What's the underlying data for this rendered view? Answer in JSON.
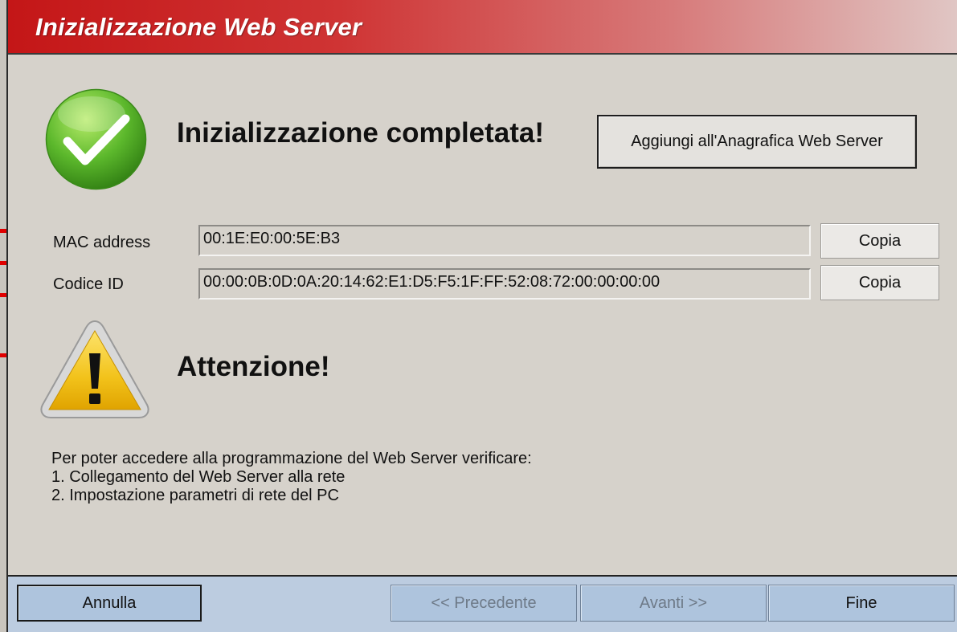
{
  "header": {
    "title": "Inizializzazione Web Server"
  },
  "success": {
    "title": "Inizializzazione completata!",
    "add_button_label": "Aggiungi all'Anagrafica Web Server",
    "icon": "checkmark-icon"
  },
  "fields": [
    {
      "label": "MAC address",
      "value": "00:1E:E0:00:5E:B3",
      "copy_label": "Copia"
    },
    {
      "label": "Codice ID",
      "value": "00:00:0B:0D:0A:20:14:62:E1:D5:F5:1F:FF:52:08:72:00:00:00:00",
      "copy_label": "Copia"
    }
  ],
  "warning": {
    "title": "Attenzione!",
    "icon": "warning-icon",
    "lines": [
      "Per poter accedere alla programmazione del Web Server verificare:",
      "1. Collegamento del Web Server alla rete",
      "2. Impostazione parametri di rete del PC"
    ]
  },
  "footer": {
    "cancel_label": "Annulla",
    "prev_label": "<< Precedente",
    "next_label": "Avanti >>",
    "finish_label": "Fine"
  },
  "colors": {
    "header_red": "#c41617",
    "background": "#d6d2cb",
    "footer": "#bccce0",
    "success_green": "#5cb82c",
    "warning_yellow": "#f2c21a"
  }
}
